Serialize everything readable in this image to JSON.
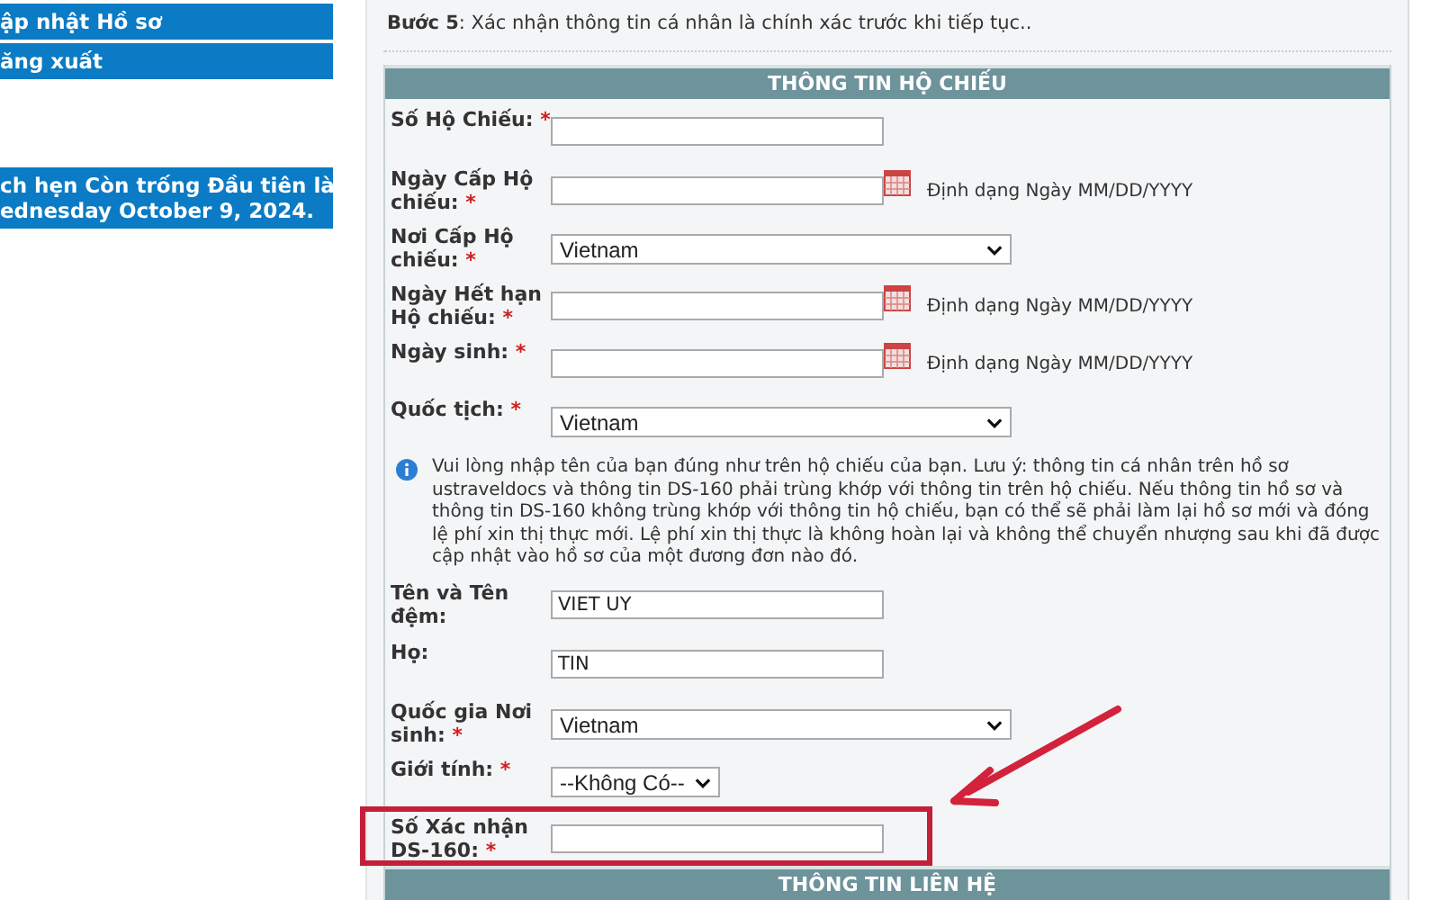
{
  "sidebar": {
    "items": [
      {
        "label": "ập nhật Hồ sơ"
      },
      {
        "label": "ăng xuất"
      }
    ],
    "banner": {
      "lines": [
        "ch hẹn Còn trống Đầu tiên là",
        "ednesday October 9, 2024."
      ]
    }
  },
  "step": {
    "label": "Bước 5",
    "text": ": Xác nhận thông tin cá nhân là chính xác trước khi tiếp tục.."
  },
  "passport_section": {
    "title": "THÔNG TIN HỘ CHIẾU",
    "fields": [
      {
        "kind": "text",
        "label": "Số Hộ Chiếu:",
        "required_mark": "*"
      },
      {
        "kind": "date",
        "label": "Ngày Cấp Hộ chiếu:",
        "required_mark": "*",
        "hint": "Định dạng Ngày MM/DD/YYYY"
      },
      {
        "kind": "select",
        "label": "Nơi Cấp Hộ chiếu:",
        "required_mark": "*",
        "value": "Vietnam"
      },
      {
        "kind": "date",
        "label": "Ngày Hết hạn Hộ chiếu:",
        "required_mark": "*",
        "hint": "Định dạng Ngày MM/DD/YYYY"
      },
      {
        "kind": "date",
        "label": "Ngày sinh:",
        "required_mark": "*",
        "hint": "Định dạng Ngày MM/DD/YYYY"
      },
      {
        "kind": "select",
        "label": "Quốc tịch:",
        "required_mark": "*",
        "value": "Vietnam"
      },
      {
        "kind": "note",
        "text": "Vui lòng nhập tên của bạn đúng như trên hộ chiếu của bạn. Lưu ý: thông tin cá nhân trên hồ sơ ustraveldocs và thông tin DS-160 phải trùng khớp với thông tin trên hộ chiếu. Nếu thông tin hồ sơ và thông tin DS-160 không trùng khớp với thông tin hộ chiếu, bạn có thể sẽ phải làm lại hồ sơ mới và đóng lệ phí xin thị thực mới. Lệ phí xin thị thực là không hoàn lại và không thể chuyển nhượng sau khi đã được cập nhật vào hồ sơ của một đương đơn nào đó."
      },
      {
        "kind": "text",
        "label": "Tên và Tên đệm:",
        "value": "VIET UY"
      },
      {
        "kind": "text",
        "label": "Họ:",
        "value": "TIN"
      },
      {
        "kind": "select",
        "label": "Quốc gia Nơi sinh:",
        "required_mark": "*",
        "value": "Vietnam"
      },
      {
        "kind": "small-select",
        "label": "Giới tính:",
        "required_mark": "*",
        "value": "--Không Có--"
      },
      {
        "kind": "text",
        "label": "Số Xác nhận DS-160:",
        "required_mark": "*",
        "highlighted": true
      }
    ]
  },
  "contact_section": {
    "title": "THÔNG TIN LIÊN HỆ"
  }
}
